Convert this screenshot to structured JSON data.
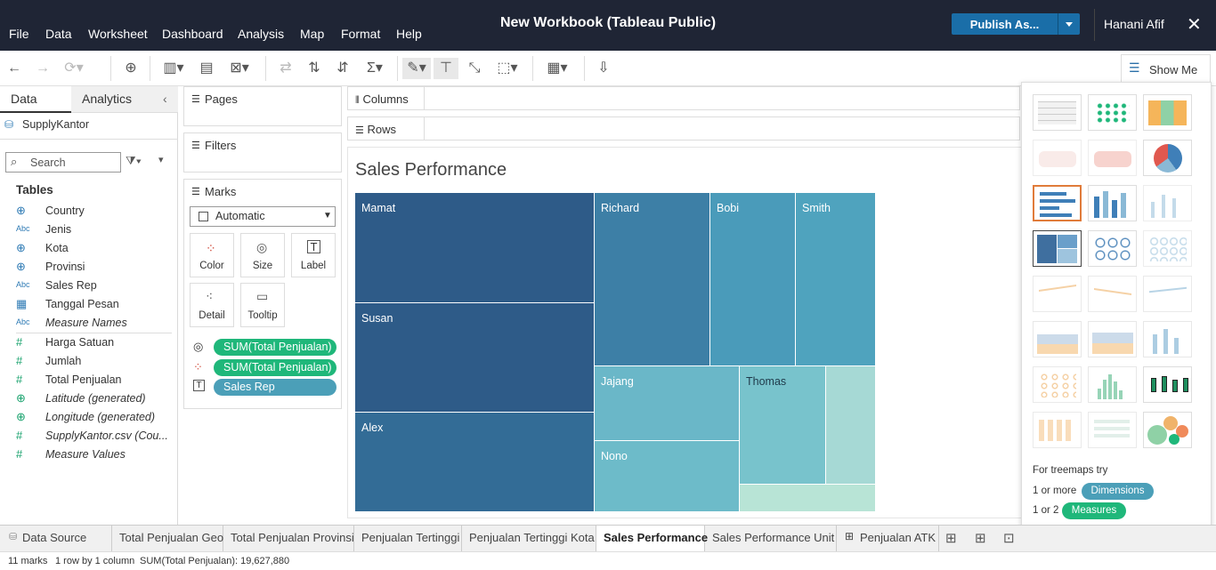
{
  "menu": [
    "File",
    "Data",
    "Worksheet",
    "Dashboard",
    "Analysis",
    "Map",
    "Format",
    "Help"
  ],
  "window_title": "New Workbook (Tableau Public)",
  "publish_label": "Publish As...",
  "user_name": "Hanani Afif",
  "show_me_label": "Show Me",
  "data_pane": {
    "tab_data": "Data",
    "tab_analytics": "Analytics",
    "datasource": "SupplyKantor",
    "search_placeholder": "Search",
    "tables_label": "Tables",
    "dimensions": [
      {
        "name": "Country",
        "icon": "globe-icon"
      },
      {
        "name": "Jenis",
        "icon": "abc-icon",
        "ic_text": "Abc"
      },
      {
        "name": "Kota",
        "icon": "globe-icon"
      },
      {
        "name": "Provinsi",
        "icon": "globe-icon"
      },
      {
        "name": "Sales Rep",
        "icon": "abc-icon",
        "ic_text": "Abc"
      },
      {
        "name": "Tanggal Pesan",
        "icon": "calendar-icon"
      },
      {
        "name": "Measure Names",
        "icon": "abc-icon",
        "ic_text": "Abc"
      }
    ],
    "measures": [
      {
        "name": "Harga Satuan",
        "icon": "hash-icon"
      },
      {
        "name": "Jumlah",
        "icon": "hash-icon"
      },
      {
        "name": "Total Penjualan",
        "icon": "hash-icon"
      },
      {
        "name": "Latitude (generated)",
        "icon": "globe-icon"
      },
      {
        "name": "Longitude (generated)",
        "icon": "globe-icon"
      },
      {
        "name": "SupplyKantor.csv (Cou...",
        "icon": "hash-icon"
      },
      {
        "name": "Measure Values",
        "icon": "hash-icon"
      }
    ]
  },
  "cards": {
    "pages": "Pages",
    "filters": "Filters",
    "marks": "Marks",
    "mark_type": "Automatic",
    "buttons": {
      "color": "Color",
      "size": "Size",
      "label": "Label",
      "detail": "Detail",
      "tooltip": "Tooltip"
    },
    "pills": [
      "SUM(Total Penjualan)",
      "SUM(Total Penjualan)",
      "Sales Rep"
    ]
  },
  "shelves": {
    "columns": "Columns",
    "rows": "Rows"
  },
  "viz": {
    "title": "Sales Performance",
    "tiles": [
      "Mamat",
      "Susan",
      "Alex",
      "Richard",
      "Bobi",
      "Smith",
      "Jajang",
      "Nono",
      "Thomas",
      "",
      ""
    ]
  },
  "showme": {
    "hint": "For treemaps try",
    "dim_req": "1 or more",
    "dim_pill": "Dimensions",
    "meas_req": "1 or 2",
    "meas_pill": "Measures"
  },
  "sheet_tabs": [
    "Data Source",
    "Total Penjualan Geo",
    "Total Penjualan Provinsi",
    "Penjualan Tertinggi",
    "Penjualan Tertinggi Kota",
    "Sales Performance",
    "Sales Performance Unit",
    "Penjualan ATK"
  ],
  "status": {
    "marks": "11 marks",
    "dims": "1 row by 1 column",
    "sum": "SUM(Total Penjualan): 19,627,880"
  },
  "colors": {
    "titlebar": "#1f2535",
    "publish": "#1a6ea8",
    "measure_pill": "#1fb77a",
    "dimension_pill": "#4b9fb8"
  }
}
